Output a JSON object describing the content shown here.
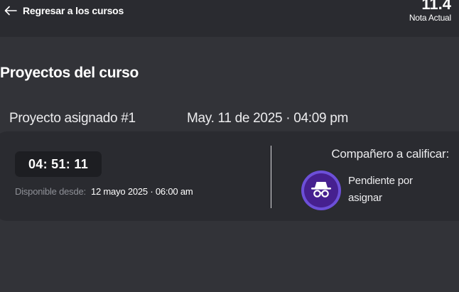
{
  "header": {
    "back_label": "Regresar a los cursos",
    "grade_value": "11.4",
    "grade_label": "Nota Actual"
  },
  "main": {
    "section_title": "Proyectos del curso",
    "project": {
      "name": "Proyecto asignado #1",
      "date": "May. 11 de 2025 · 04:09 pm",
      "timer": "04: 51: 11",
      "available_label": "Disponible desde:",
      "available_value": "12 mayo 2025 · 06:00 am",
      "peer_title": "Compañero a calificar:",
      "peer_status": "Pendiente por asignar",
      "peer_icon": "incognito-icon"
    }
  },
  "colors": {
    "background": "#323338",
    "card": "#2a2b30",
    "timer_bg": "#1d1e22",
    "avatar_ring": "#6c4fd8",
    "avatar_fill": "#46208f"
  }
}
